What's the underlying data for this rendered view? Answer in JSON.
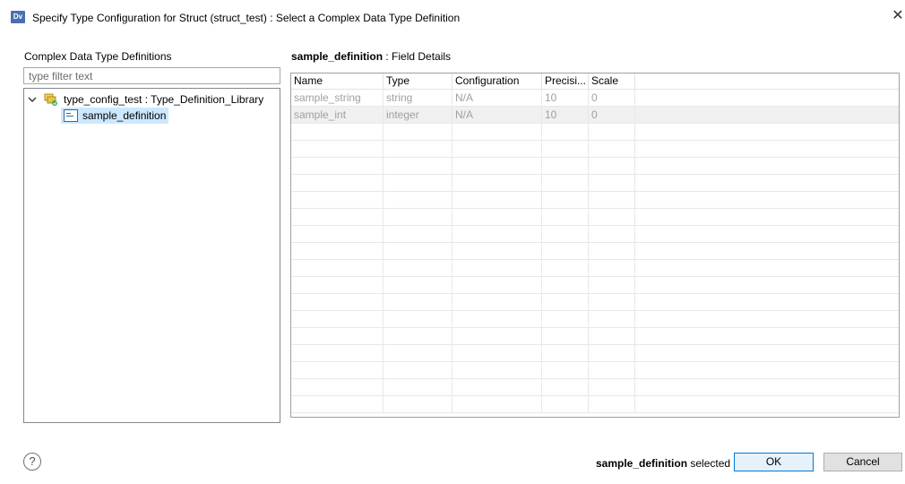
{
  "window": {
    "app_icon": "Dv",
    "title": "Specify Type Configuration for Struct (struct_test) : Select a Complex Data Type Definition",
    "close_glyph": "✕"
  },
  "left_panel": {
    "label": "Complex Data Type Definitions",
    "filter_placeholder": "type filter text",
    "tree": {
      "library_label": "type_config_test : Type_Definition_Library",
      "library_icon": "library-icon",
      "expanded": true,
      "children": [
        {
          "label": "sample_definition",
          "icon": "definition-icon",
          "selected": true
        }
      ]
    }
  },
  "right_panel": {
    "title_name": "sample_definition",
    "title_suffix": " : Field Details",
    "columns": [
      "Name",
      "Type",
      "Configuration",
      "Precisi...",
      "Scale"
    ],
    "rows": [
      [
        "sample_string",
        "string",
        "N/A",
        "10",
        "0"
      ],
      [
        "sample_int",
        "integer",
        "N/A",
        "10",
        "0"
      ]
    ]
  },
  "footer": {
    "help_glyph": "?",
    "status_name": "sample_definition",
    "status_suffix": " selected",
    "ok_label": "OK",
    "cancel_label": "Cancel"
  },
  "colors": {
    "selection": "#cce8ff",
    "ok_border": "#0078d7",
    "disabled_text": "#a0a0a0"
  }
}
